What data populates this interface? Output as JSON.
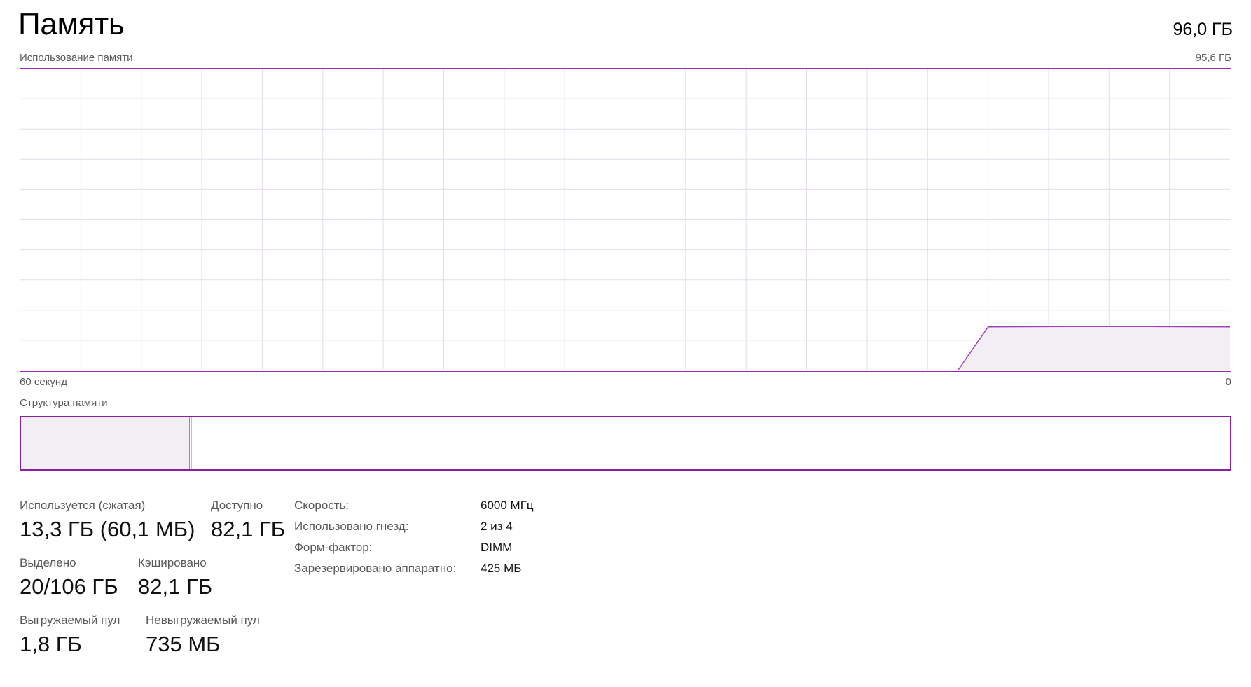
{
  "header": {
    "title": "Память",
    "total": "96,0 ГБ"
  },
  "usage_graph": {
    "label": "Использование памяти",
    "max_label": "95,6 ГБ",
    "time_left_label": "60 секунд",
    "time_right_label": "0",
    "colors": {
      "border": "#9c2bb3",
      "line": "#a13fbd",
      "fill": "#f2eff4",
      "grid": "#e4dbe8"
    }
  },
  "chart_data": {
    "type": "area",
    "x": [
      60,
      13.5,
      12,
      8,
      4,
      0
    ],
    "values": [
      0,
      0,
      13.8,
      13.9,
      13.9,
      13.8
    ],
    "ylim": [
      0,
      95.6
    ],
    "xlim": [
      60,
      0
    ],
    "grid": true
  },
  "composition": {
    "label": "Структура памяти",
    "in_use_fraction": 0.139,
    "modified_fraction": 0.002
  },
  "stats": {
    "in_use_label": "Используется (сжатая)",
    "in_use_value": "13,3 ГБ (60,1 МБ)",
    "available_label": "Доступно",
    "available_value": "82,1 ГБ",
    "committed_label": "Выделено",
    "committed_value": "20/106 ГБ",
    "cached_label": "Кэшировано",
    "cached_value": "82,1 ГБ",
    "paged_pool_label": "Выгружаемый пул",
    "paged_pool_value": "1,8 ГБ",
    "nonpaged_pool_label": "Невыгружаемый пул",
    "nonpaged_pool_value": "735 МБ"
  },
  "specs": [
    {
      "label": "Скорость:",
      "value": "6000 МГц"
    },
    {
      "label": "Использовано гнезд:",
      "value": "2 из 4"
    },
    {
      "label": "Форм-фактор:",
      "value": "DIMM"
    },
    {
      "label": "Зарезервировано аппаратно:",
      "value": "425 МБ"
    }
  ]
}
